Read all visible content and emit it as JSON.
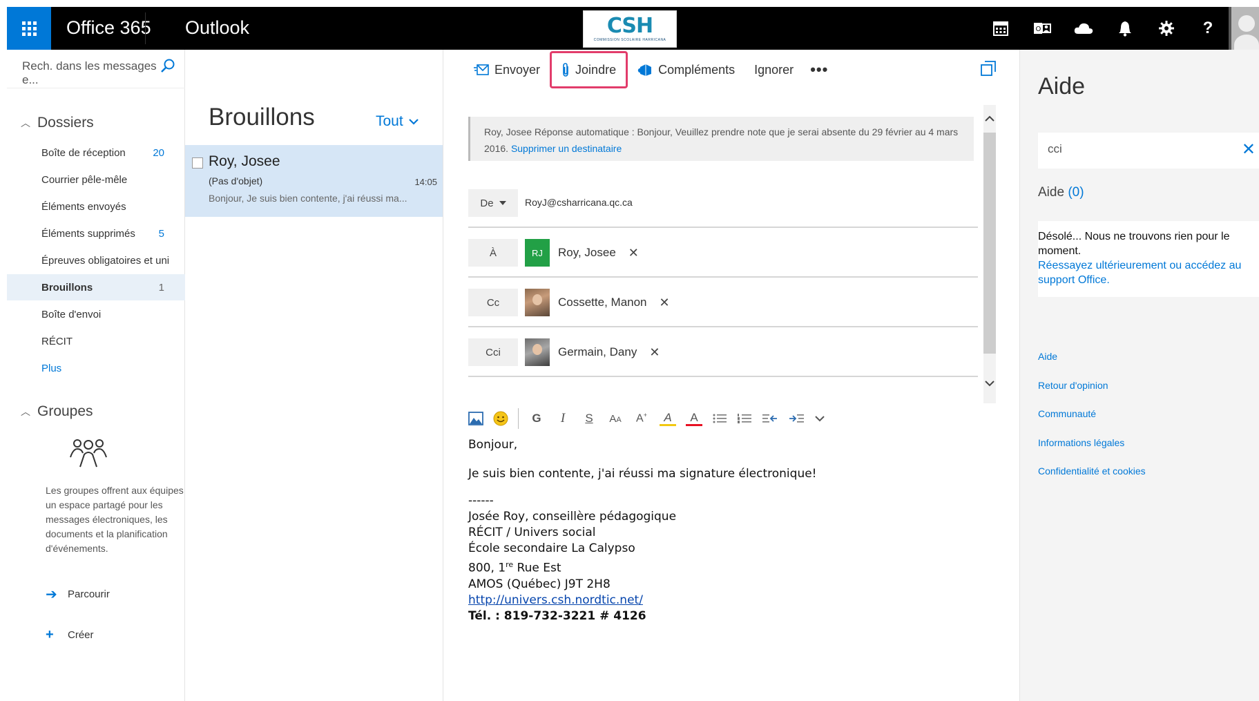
{
  "topbar": {
    "brand": "Office 365",
    "app": "Outlook",
    "logo_text": "CSH",
    "logo_subtitle": "COMMISSION SCOLAIRE HARRICANA",
    "icons": [
      "calendar-icon",
      "people-icon",
      "onedrive-icon",
      "bell-icon",
      "gear-icon",
      "help-icon"
    ],
    "help_glyph": "?"
  },
  "leftnav": {
    "search_placeholder": "Rech. dans les messages e...",
    "folders_header": "Dossiers",
    "folders": [
      {
        "label": "Boîte de réception",
        "count": "20"
      },
      {
        "label": "Courrier pêle-mêle",
        "count": ""
      },
      {
        "label": "Éléments envoyés",
        "count": ""
      },
      {
        "label": "Éléments supprimés",
        "count": "5"
      },
      {
        "label": "Épreuves obligatoires et uni",
        "count": ""
      },
      {
        "label": "Brouillons",
        "count": "1"
      },
      {
        "label": "Boîte d'envoi",
        "count": ""
      },
      {
        "label": "RÉCIT",
        "count": ""
      },
      {
        "label": "Plus",
        "count": ""
      }
    ],
    "groups_header": "Groupes",
    "groups_description": "Les groupes offrent aux équipes un espace partagé pour les messages électroniques, les documents et la planification d'événements.",
    "browse_label": "Parcourir",
    "create_label": "Créer"
  },
  "msglist": {
    "title": "Brouillons",
    "filter": "Tout",
    "items": [
      {
        "from": "Roy, Josee",
        "subject": "(Pas d'objet)",
        "time": "14:05",
        "preview": "Bonjour, Je suis bien contente, j'ai réussi ma..."
      }
    ]
  },
  "compose": {
    "commands": {
      "send": "Envoyer",
      "attach": "Joindre",
      "addins": "Compléments",
      "discard": "Ignorer",
      "more": "•••"
    },
    "autoreply_text": "Roy, Josee Réponse automatique : Bonjour, Veuillez prendre note que je serai absente du 29 février au 4 mars 2016.",
    "autoreply_link": "Supprimer un destinataire",
    "from_label": "De",
    "from_value": "RoyJ@csharricana.qc.ca",
    "to_label": "À",
    "to_initials": "RJ",
    "to_name": "Roy, Josee",
    "cc_label": "Cc",
    "cc_name": "Cossette, Manon",
    "bcc_label": "Cci",
    "bcc_name": "Germain, Dany",
    "remove_glyph": "✕",
    "format": {
      "bold": "G",
      "italic": "I",
      "underline": "S",
      "font_size": "A",
      "grow": "A",
      "highlight": "A",
      "font_color": "A"
    },
    "body": {
      "greeting": "Bonjour,",
      "line1": "Je suis bien contente, j'ai réussi ma signature électronique!",
      "dashes": "------",
      "sig_name": "Josée Roy, conseillère pédagogique",
      "sig_dept": "RÉCIT / Univers social",
      "sig_school": "École secondaire La Calypso",
      "sig_addr_num": "800, 1",
      "sig_addr_sup": "re",
      "sig_addr_rest": " Rue Est",
      "sig_city": "AMOS  (Québec)  J9T 2H8",
      "sig_url": "http://univers.csh.nordtic.net/",
      "sig_tel": "Tél. : 819-732-3221 # 4126"
    }
  },
  "help": {
    "title": "Aide",
    "search_value": "cci",
    "results_label": "Aide",
    "results_count": "(0)",
    "no_results_line": "Désolé... Nous ne trouvons rien pour le moment.",
    "no_results_link": "Réessayez ultérieurement ou accédez au support Office.",
    "links": [
      "Aide",
      "Retour d'opinion",
      "Communauté",
      "Informations légales",
      "Confidentialité et cookies"
    ]
  }
}
